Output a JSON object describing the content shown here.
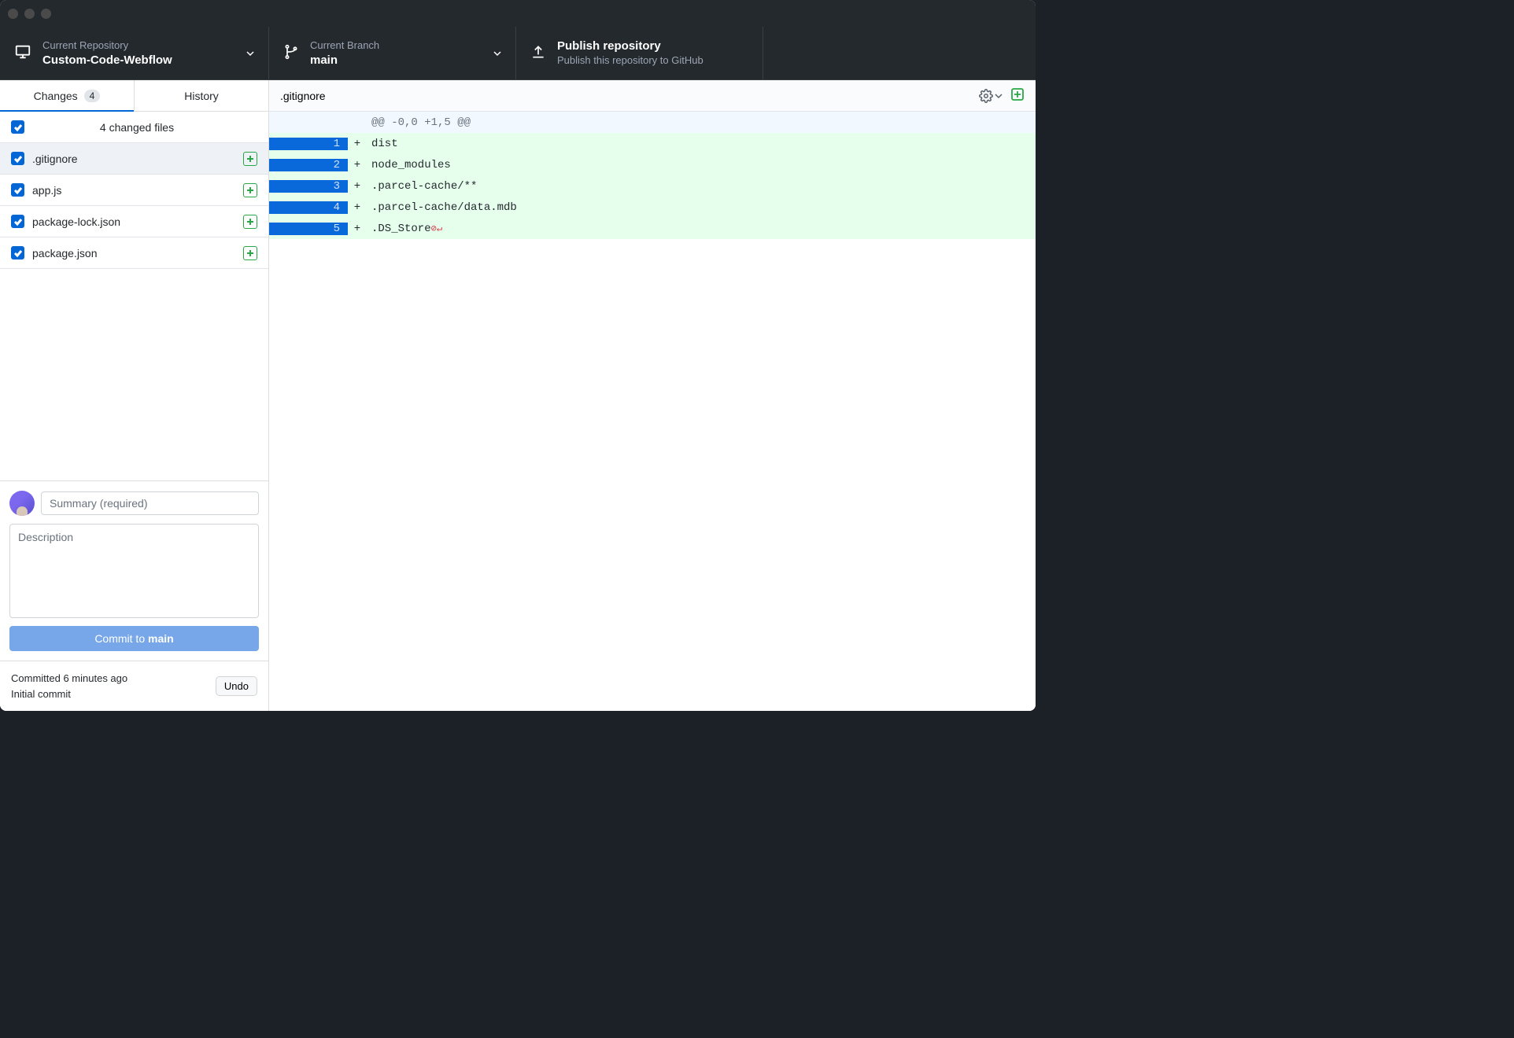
{
  "toolbar": {
    "repo": {
      "label": "Current Repository",
      "value": "Custom-Code-Webflow"
    },
    "branch": {
      "label": "Current Branch",
      "value": "main"
    },
    "publish": {
      "title": "Publish repository",
      "sub": "Publish this repository to GitHub"
    }
  },
  "tabs": {
    "changes": {
      "label": "Changes",
      "count": "4"
    },
    "history": {
      "label": "History"
    }
  },
  "files": {
    "header": "4 changed files",
    "list": [
      {
        "name": ".gitignore",
        "status": "added",
        "selected": true
      },
      {
        "name": "app.js",
        "status": "added",
        "selected": false
      },
      {
        "name": "package-lock.json",
        "status": "added",
        "selected": false
      },
      {
        "name": "package.json",
        "status": "added",
        "selected": false
      }
    ]
  },
  "commit": {
    "summary_placeholder": "Summary (required)",
    "description_placeholder": "Description",
    "button_prefix": "Commit to ",
    "button_branch": "main"
  },
  "lastCommit": {
    "time": "Committed 6 minutes ago",
    "message": "Initial commit",
    "undo": "Undo"
  },
  "diff": {
    "filename": ".gitignore",
    "hunk": "@@ -0,0 +1,5 @@",
    "lines": [
      {
        "n": "1",
        "text": "dist"
      },
      {
        "n": "2",
        "text": "node_modules"
      },
      {
        "n": "3",
        "text": ".parcel-cache/**"
      },
      {
        "n": "4",
        "text": ".parcel-cache/data.mdb"
      },
      {
        "n": "5",
        "text": ".DS_Store",
        "eol": true
      }
    ]
  }
}
